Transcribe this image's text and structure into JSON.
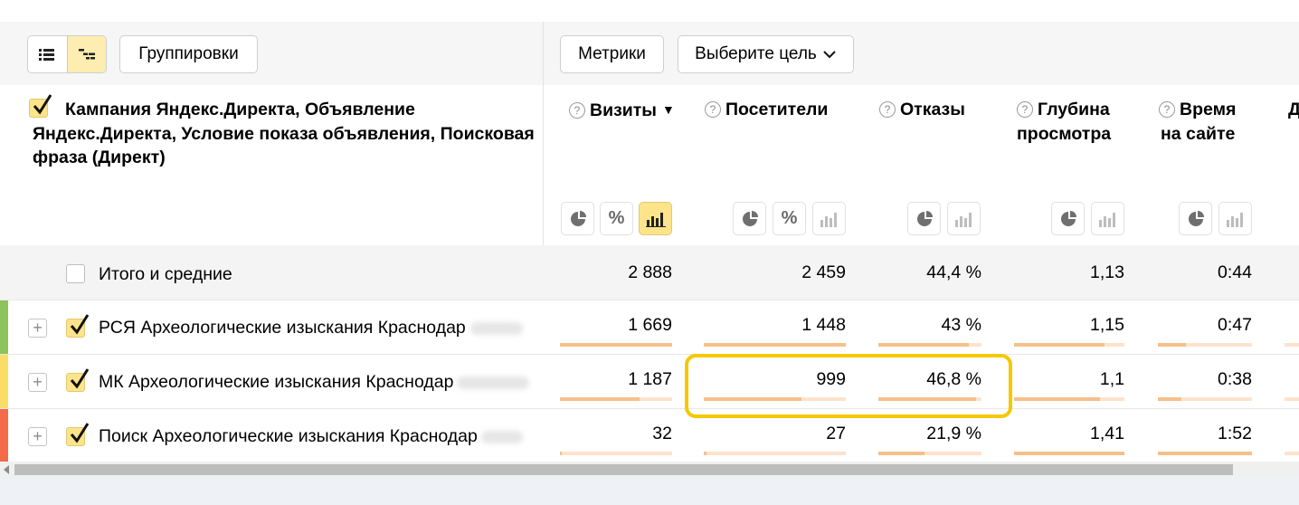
{
  "toolbar": {
    "group_label": "Группировки",
    "metrics_label": "Метрики",
    "goal_label": "Выберите цель"
  },
  "dimension_header": "Кампания Яндекс.Директа, Объявление Яндекс.Директа, Условие показа объявления, Поисковая фраза (Директ)",
  "columns": [
    {
      "title_1": "Визиты",
      "title_2": "",
      "sort": "▼"
    },
    {
      "title_1": "Посетители",
      "title_2": ""
    },
    {
      "title_1": "Отказы",
      "title_2": ""
    },
    {
      "title_1": "Глубина",
      "title_2": "просмотра"
    },
    {
      "title_1": "Время",
      "title_2": "на сайте"
    },
    {
      "title_1": "Д",
      "title_2": ""
    }
  ],
  "icons": {
    "q": "?",
    "percent": "%"
  },
  "totals": {
    "label": "Итого и средние",
    "values": [
      "2 888",
      "2 459",
      "44,4 %",
      "1,13",
      "0:44"
    ]
  },
  "rows": [
    {
      "label": "РСЯ Археологические изыскания Краснодар",
      "strip_color": "#8cc35c",
      "values": [
        "1 669",
        "1 448",
        "43 %",
        "1,15",
        "0:47"
      ],
      "fractions": [
        1.0,
        1.0,
        0.88,
        0.82,
        0.3
      ]
    },
    {
      "label": "МК Археологические изыскания Краснодар",
      "strip_color": "#fbdc65",
      "values": [
        "1 187",
        "999",
        "46,8 %",
        "1,1",
        "0:38"
      ],
      "fractions": [
        0.71,
        0.69,
        0.95,
        0.78,
        0.25
      ]
    },
    {
      "label": "Поиск Археологические изыскания Краснодар",
      "strip_color": "#f56a47",
      "values": [
        "32",
        "27",
        "21,9 %",
        "1,41",
        "1:52"
      ],
      "fractions": [
        0.02,
        0.02,
        0.45,
        1.0,
        1.0
      ]
    }
  ],
  "colors": {
    "accent_yellow": "#fde48a",
    "highlight": "#f5c800",
    "bar_fill": "#f5c08a",
    "bar_track": "#fde3cc"
  }
}
